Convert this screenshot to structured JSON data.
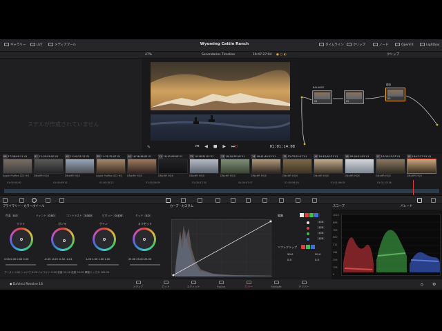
{
  "project_title": "Wyoming Cattle Ranch",
  "topbar": {
    "left": [
      "ギャラリー",
      "LUT",
      "メディアプール"
    ],
    "right": [
      "タイムライン",
      "クリップ",
      "ノード",
      "OpenFX",
      "Lightbox"
    ]
  },
  "viewer": {
    "zoom": "47%",
    "timeline_name": "Secondaries Timeline",
    "header_timecode": "16:47:27:04",
    "timecode": "01:01:14:08",
    "clip_label": "クリップ"
  },
  "gallery": {
    "empty_message": "ステルが作成されていません"
  },
  "nodes": [
    {
      "name": "BALANCE",
      "label": "01"
    },
    {
      "name": "",
      "label": "02"
    },
    {
      "name": "視覚",
      "label": "03"
    }
  ],
  "clips": [
    {
      "num": "06",
      "tc": "17:36:44:11",
      "track": "V1",
      "codec": "Apple ProRes 422 HQ",
      "colors": [
        "#7a6e62",
        "#3e3e40"
      ]
    },
    {
      "num": "07",
      "tc": "11:05:55:00",
      "track": "V1",
      "codec": "DNxHR HQX",
      "colors": [
        "#5c5a58",
        "#232326"
      ]
    },
    {
      "num": "08",
      "tc": "11:04:31:12",
      "track": "V1",
      "codec": "DNxHR HQX",
      "colors": [
        "#98a7bb",
        "#4b4d52"
      ]
    },
    {
      "num": "09",
      "tc": "11:51:32:02",
      "track": "V1",
      "codec": "Apple ProRes 422 HQ",
      "colors": [
        "#a58a6b",
        "#3b2d22"
      ]
    },
    {
      "num": "10",
      "tc": "16:26:36:05",
      "track": "V1",
      "codec": "DNxHR HQX",
      "colors": [
        "#a07a5c",
        "#2f2420"
      ]
    },
    {
      "num": "11",
      "tc": "16:42:06:06",
      "track": "V1",
      "codec": "DNxHR HQX",
      "colors": [
        "#222327",
        "#111114"
      ]
    },
    {
      "num": "12",
      "tc": "10:28:51:03",
      "track": "V1",
      "codec": "DNxHR HQX",
      "colors": [
        "#b6bcc6",
        "#5b6370"
      ]
    },
    {
      "num": "13",
      "tc": "16:34:26:18",
      "track": "V1",
      "codec": "DNxHR HQX",
      "colors": [
        "#7e8f78",
        "#3c4434"
      ]
    },
    {
      "num": "14",
      "tc": "16:41:49:23",
      "track": "V1",
      "codec": "DNxHR HQX",
      "colors": [
        "#b39a7b",
        "#2c2620"
      ]
    },
    {
      "num": "15",
      "tc": "12:03:25:07",
      "track": "V1",
      "codec": "DNxHR HQX",
      "colors": [
        "#7d6a49",
        "#3d3424"
      ]
    },
    {
      "num": "15",
      "tc": "16:43:40:21",
      "track": "V1",
      "codec": "DNxHR HQX",
      "colors": [
        "#c3ad8b",
        "#3e362c"
      ]
    },
    {
      "num": "16",
      "tc": "09:34:31:05",
      "track": "V1",
      "codec": "DNxHR HQX",
      "colors": [
        "#d4d7dd",
        "#7d8591"
      ]
    },
    {
      "num": "17",
      "tc": "10:00:13:23",
      "track": "V1",
      "codec": "DNxHR HQX",
      "colors": [
        "#8c7a62",
        "#2f2a23"
      ]
    },
    {
      "num": "18",
      "tc": "16:47:27:01",
      "track": "V1",
      "codec": "DNxHR HQX",
      "colors": [
        "#c9a77d",
        "#3a2d21"
      ]
    }
  ],
  "ruler_marks": [
    "01:00:00:00",
    "01:00:09:11",
    "01:00:18:22",
    "01:00:28:09",
    "01:00:37:20",
    "01:00:47:07",
    "01:00:56:18",
    "01:01:06:05",
    "01:01:15:16"
  ],
  "panels": {
    "wheels_title": "プライマリー - カラーホイール",
    "curves_title": "カーブ - カスタム",
    "scopes_title": "スコープ",
    "parade": "パレード",
    "channels_title": "編集",
    "soft_clip": "ソフトクリップ"
  },
  "wheel_params": [
    {
      "label": "色温",
      "value": "0.0"
    },
    {
      "label": "ティント",
      "value": "0.00"
    },
    {
      "label": "コントラスト",
      "value": "1.000"
    },
    {
      "label": "ピボット",
      "value": "0.435"
    },
    {
      "label": "ミッド",
      "value": "0.0"
    }
  ],
  "wheels": [
    {
      "name": "リフト",
      "values": "0.00  0.00  0.00  0.00"
    },
    {
      "name": "ガンマ",
      "values": "-0.05  -0.05  -0.02  -0.01"
    },
    {
      "name": "ゲイン",
      "values": "1.00  1.00  1.00  1.00"
    },
    {
      "name": "オフセット",
      "values": "25.00  25.00  25.00"
    }
  ],
  "bottom_params": "ブースト  0.00    シャドウ  0.00    ハイライト  0.00    彩度  50.00    色相  50.00    輝度ミックス  100.00",
  "channels": [
    {
      "color": "#e5e5e5",
      "value": "100"
    },
    {
      "color": "#d94040",
      "value": "100"
    },
    {
      "color": "#3fbf4f",
      "value": "100"
    },
    {
      "color": "#3f6fd9",
      "value": "100"
    }
  ],
  "soft_clip_values": {
    "low": "50.0",
    "high": "50.0",
    "ls": "0.0",
    "hs": "0.0"
  },
  "scope_axis": [
    "1023",
    "896",
    "768",
    "640",
    "512",
    "384",
    "256",
    "128",
    "0"
  ],
  "app_name": "DaVinci Resolve 16",
  "pages": [
    {
      "label": "メディア",
      "active": false
    },
    {
      "label": "カット",
      "active": false
    },
    {
      "label": "エディット",
      "active": false
    },
    {
      "label": "Fusion",
      "active": false
    },
    {
      "label": "カラー",
      "active": true
    },
    {
      "label": "Fairlight",
      "active": false
    },
    {
      "label": "デリバー",
      "active": false
    }
  ],
  "colors": {
    "accent": "#e94b6a",
    "playhead": "#e03c31"
  }
}
